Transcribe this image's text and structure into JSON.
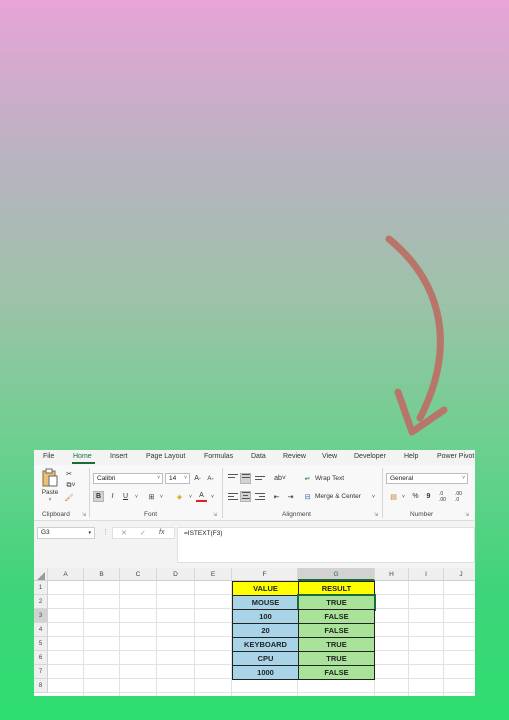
{
  "decor": {
    "arrow_color": "#b8766a",
    "icon": "curved-arrow-icon"
  },
  "menu": {
    "tabs": [
      "File",
      "Home",
      "Insert",
      "Page Layout",
      "Formulas",
      "Data",
      "Review",
      "View",
      "Developer",
      "Help",
      "Power Pivot"
    ],
    "active_tab": "Home"
  },
  "ribbon": {
    "clipboard": {
      "paste_label": "Paste",
      "group_label": "Clipboard"
    },
    "font": {
      "font_name": "Calibri",
      "font_size": "14",
      "bold": "B",
      "italic": "I",
      "underline": "U",
      "grow": "A^",
      "shrink": "A˅",
      "font_color_letter": "A",
      "group_label": "Font"
    },
    "alignment": {
      "wrap_text": "Wrap Text",
      "merge_center": "Merge & Center",
      "group_label": "Alignment"
    },
    "number": {
      "format": "General",
      "percent": "%",
      "comma": "9",
      "group_label": "Number"
    }
  },
  "formula_bar": {
    "name_box": "G3",
    "cancel": "✕",
    "enter": "✓",
    "fx": "fx",
    "formula": "=ISTEXT(F3)"
  },
  "sheet": {
    "columns": [
      "A",
      "B",
      "C",
      "D",
      "E",
      "F",
      "G",
      "H",
      "I",
      "J"
    ],
    "selected_column": "G",
    "rows": [
      "1",
      "2",
      "3",
      "4",
      "5",
      "6",
      "7",
      "8"
    ],
    "selected_row": "3",
    "active_cell": "G3",
    "table": {
      "headers": [
        "VALUE",
        "RESULT"
      ],
      "values": [
        "MOUSE",
        "100",
        "20",
        "KEYBOARD",
        "CPU",
        "1000"
      ],
      "results": [
        "TRUE",
        "FALSE",
        "FALSE",
        "TRUE",
        "TRUE",
        "FALSE"
      ]
    },
    "colors": {
      "header_fill": "#ffff00",
      "value_fill": "#a9d4e8",
      "result_fill": "#a9e39a",
      "accent": "#1e6b3a"
    }
  }
}
